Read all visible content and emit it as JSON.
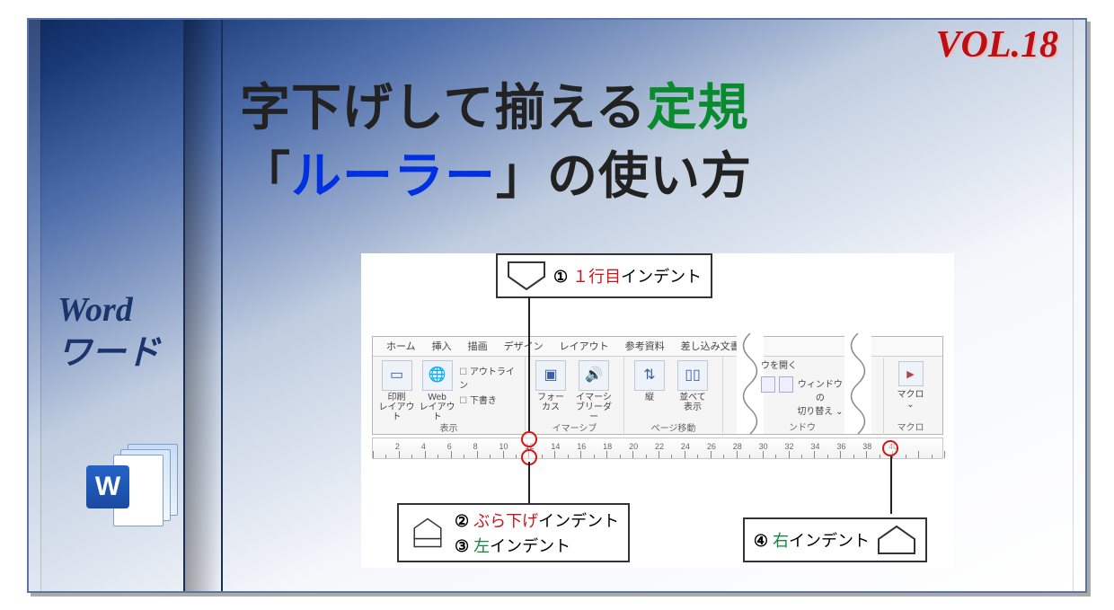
{
  "volume": "VOL.18",
  "headline": {
    "part1": "字下げして揃える",
    "accent1": "定規",
    "part2a": "「",
    "accent2": "ルーラー",
    "part2b": "」の使い方"
  },
  "left_labels": {
    "l1": "Word",
    "l2": "ワード"
  },
  "word_badge": "W",
  "callout_top": {
    "num": "①",
    "accent": "１行目",
    "rest": "インデント"
  },
  "callout_bl": {
    "row1": {
      "num": "②",
      "accent": "ぶら下げ",
      "rest": "インデント"
    },
    "row2": {
      "num": "③",
      "accent": "左",
      "rest": "インデント"
    }
  },
  "callout_br": {
    "num": "④",
    "accent": "右",
    "rest": "インデント"
  },
  "ribbon": {
    "tabs": [
      "ホーム",
      "挿入",
      "描画",
      "デザイン",
      "レイアウト",
      "参考資料",
      "差し込み文書"
    ],
    "groups": {
      "view": {
        "label": "表示",
        "btn1": "印刷\nレイアウト",
        "btn2": "Web\nレイアウト",
        "mini": [
          "アウトライン",
          "下書き"
        ]
      },
      "immersive": {
        "label": "イマーシブ",
        "btn1": "フォー\nカス",
        "btn2": "イマーシ\nブリーダー"
      },
      "pagemove": {
        "label": "ページ移動",
        "btn1": "縦",
        "btn2": "並べて\n表示"
      },
      "window": {
        "label": "ンドウ",
        "open": "ウを開く",
        "switch": "ウィンドウの\n切り替え ⌄"
      },
      "macro": {
        "label": "マクロ",
        "btn": "マクロ\n⌄"
      }
    }
  },
  "ruler_numbers": [
    2,
    4,
    6,
    8,
    10,
    12,
    14,
    16,
    18,
    20,
    22,
    24,
    26,
    28,
    30,
    32,
    34,
    36,
    38,
    40
  ]
}
